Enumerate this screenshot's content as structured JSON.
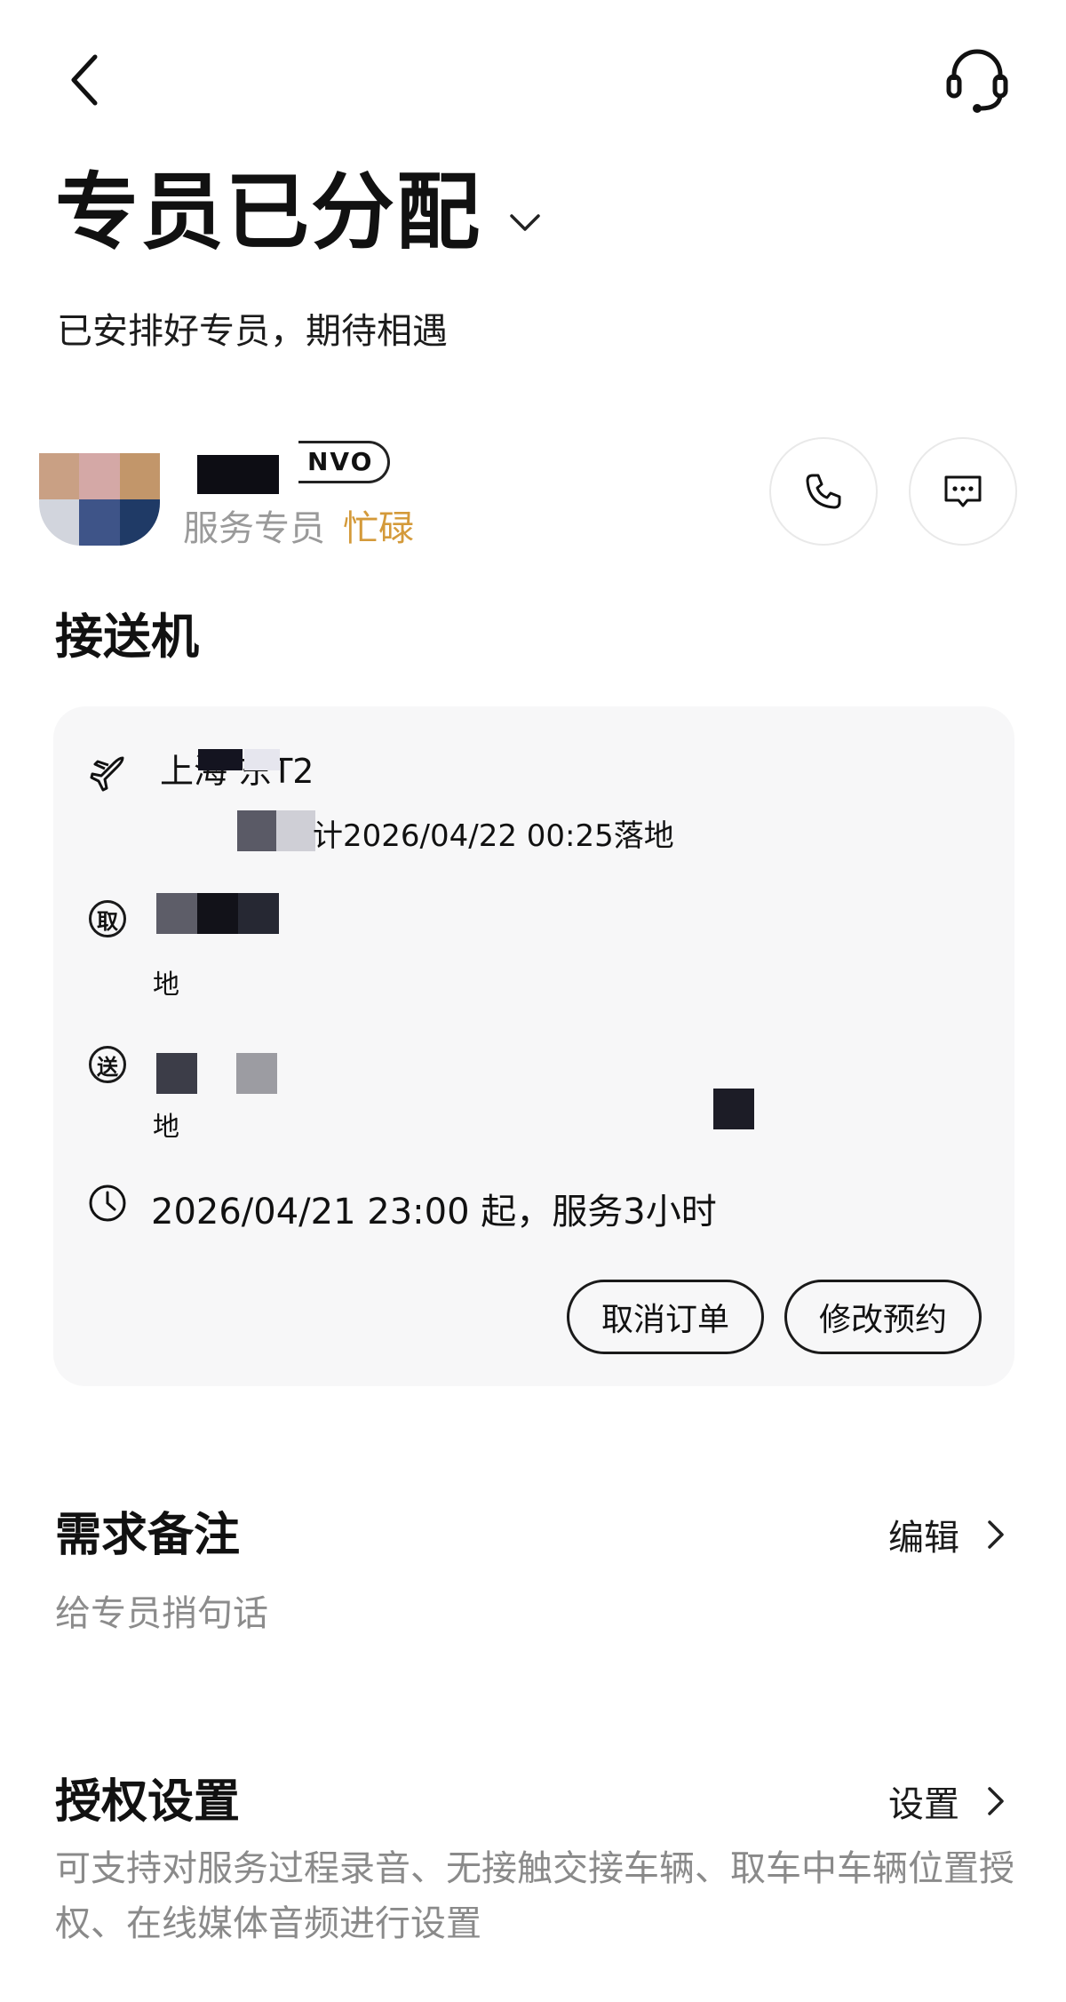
{
  "header": {
    "back_icon": "chevron-left-icon",
    "support_icon": "headset-icon"
  },
  "status": {
    "title": "专员已分配",
    "subtitle": "已安排好专员，期待相遇"
  },
  "staff": {
    "badge": "NVO",
    "role": "服务专员",
    "status": "忙碌",
    "status_color": "#d49a3a",
    "phone_icon": "phone-icon",
    "message_icon": "chat-icon"
  },
  "service": {
    "type": "接送机"
  },
  "order": {
    "flight_terminal": "上海  东T2",
    "flight_landing": "计2026/04/22 00:25落地",
    "pickup_icon_char": "取",
    "pickup_address_prefix": "地",
    "dropoff_icon_char": "送",
    "dropoff_address_prefix": "地",
    "service_time": "2026/04/21 23:00 起，服务3小时",
    "cancel_label": "取消订单",
    "modify_label": "修改预约"
  },
  "remarks": {
    "title": "需求备注",
    "action": "编辑",
    "placeholder": "给专员捎句话"
  },
  "authorization": {
    "title": "授权设置",
    "action": "设置",
    "description": "可支持对服务过程录音、无接触交接车辆、取车中车辆位置授权、在线媒体音频进行设置"
  }
}
